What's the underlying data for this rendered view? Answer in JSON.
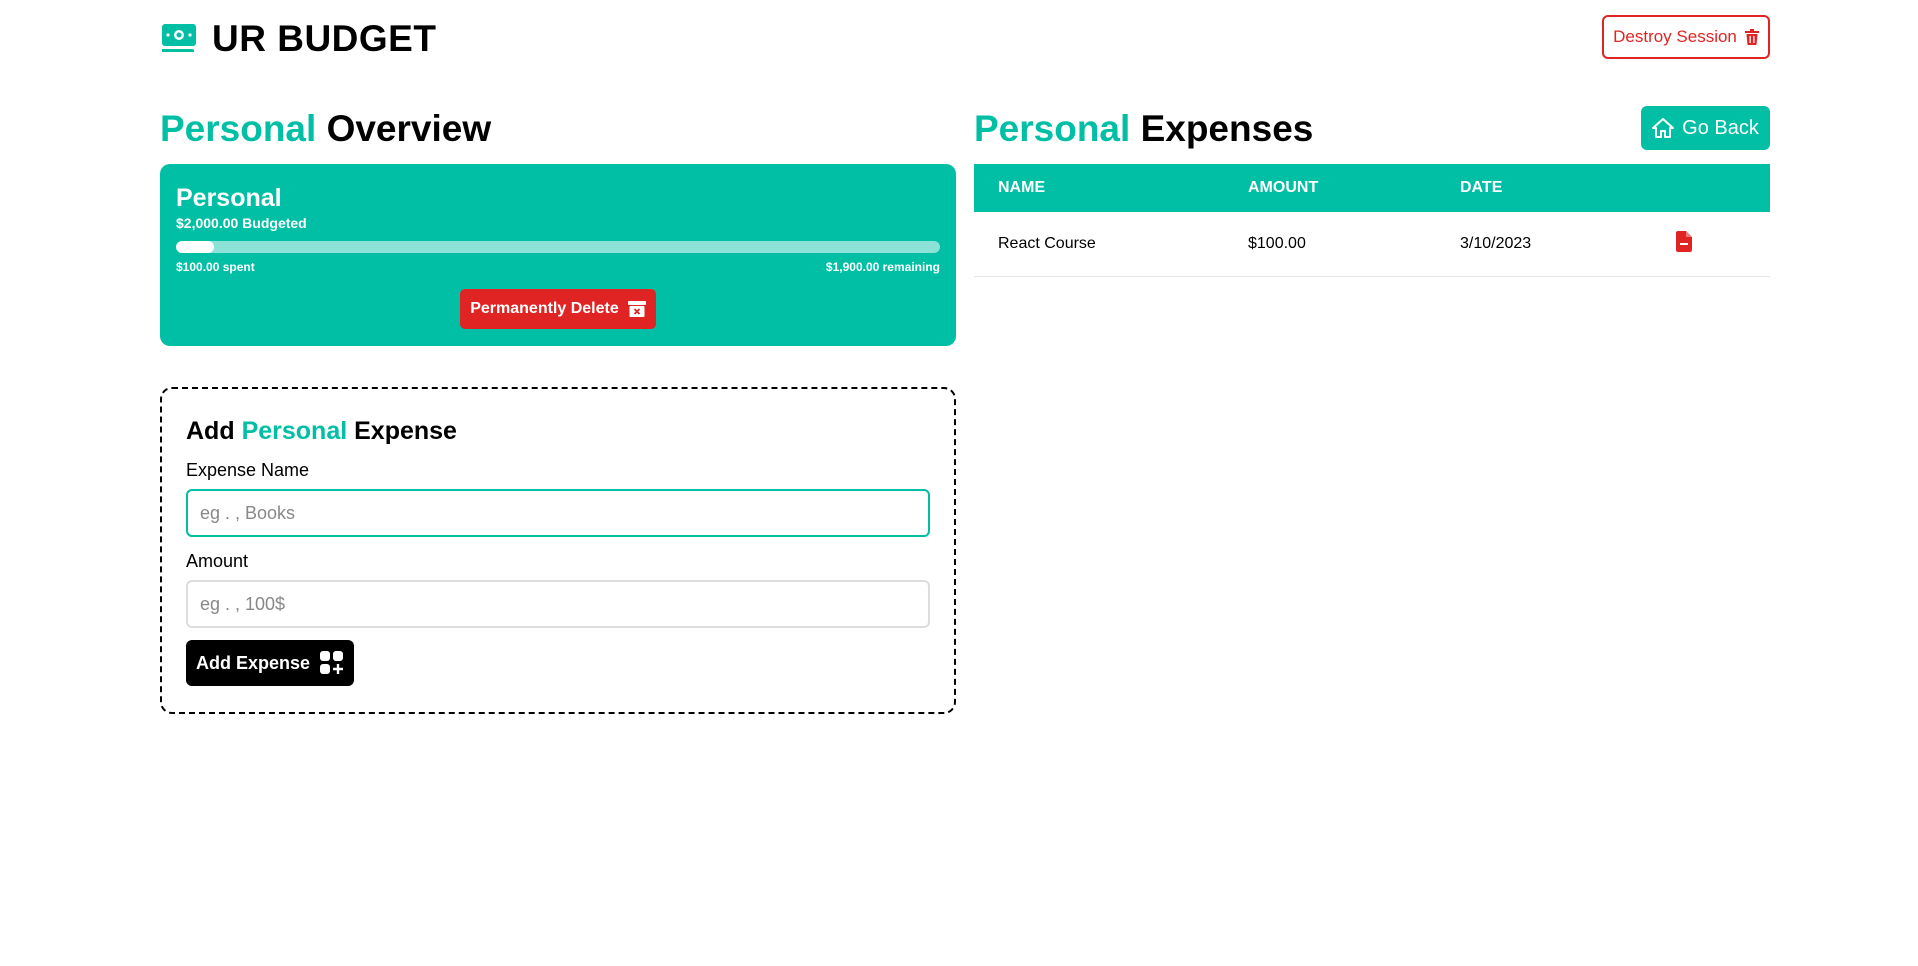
{
  "header": {
    "brand": "UR BUDGET",
    "destroy_label": "Destroy Session"
  },
  "overview": {
    "title_accent": "Personal",
    "title_rest": "Overview"
  },
  "budget": {
    "name": "Personal",
    "budgeted": "$2,000.00 Budgeted",
    "spent": "$100.00 spent",
    "remaining": "$1,900.00 remaining",
    "progress_fraction": 0.05,
    "delete_label": "Permanently Delete"
  },
  "form": {
    "title_add": "Add",
    "title_accent": "Personal",
    "title_rest": "Expense",
    "name_label": "Expense Name",
    "name_placeholder": "eg . , Books",
    "amount_label": "Amount",
    "amount_placeholder": "eg . , 100$",
    "submit_label": "Add Expense"
  },
  "expenses": {
    "title_accent": "Personal",
    "title_rest": "Expenses",
    "go_back_label": "Go Back",
    "columns": [
      "NAME",
      "AMOUNT",
      "DATE"
    ],
    "rows": [
      {
        "name": "React Course",
        "amount": "$100.00",
        "date": "3/10/2023"
      }
    ]
  },
  "colors": {
    "accent": "#00bfa5",
    "danger": "#e02424"
  },
  "icons": {
    "brand": "money-bill-icon",
    "destroy": "trash-icon",
    "delete": "archive-x-icon",
    "add": "grid-plus-icon",
    "home": "home-icon",
    "row_delete": "file-minus-icon"
  }
}
